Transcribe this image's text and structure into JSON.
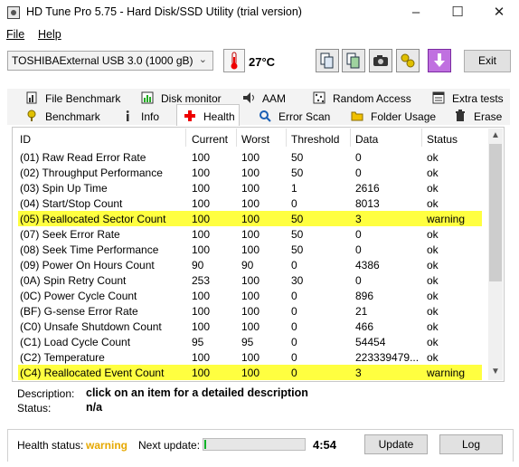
{
  "window": {
    "title": "HD Tune Pro 5.75 - Hard Disk/SSD Utility (trial version)",
    "controls": {
      "minimize": "–",
      "maximize": "☐",
      "close": "✕"
    }
  },
  "menu": {
    "file": "File",
    "help": "Help"
  },
  "toolbar": {
    "drive": "TOSHIBAExternal USB 3.0 (1000 gB)",
    "temperature": "27°C",
    "exit_label": "Exit",
    "icons": [
      "copy-info-icon",
      "copy-screenshot-icon",
      "camera-icon",
      "options-icon",
      "save-arrow-icon"
    ]
  },
  "tabs": {
    "row1": [
      {
        "label": "File Benchmark",
        "icon": "file-benchmark-icon"
      },
      {
        "label": "Disk monitor",
        "icon": "disk-monitor-icon"
      },
      {
        "label": "AAM",
        "icon": "speaker-icon"
      },
      {
        "label": "Random Access",
        "icon": "random-access-icon"
      },
      {
        "label": "Extra tests",
        "icon": "extra-tests-icon"
      }
    ],
    "row2": [
      {
        "label": "Benchmark",
        "icon": "benchmark-icon"
      },
      {
        "label": "Info",
        "icon": "info-icon"
      },
      {
        "label": "Health",
        "icon": "health-cross-icon"
      },
      {
        "label": "Error Scan",
        "icon": "error-scan-icon"
      },
      {
        "label": "Folder Usage",
        "icon": "folder-icon"
      },
      {
        "label": "Erase",
        "icon": "erase-icon"
      }
    ],
    "active": "Health"
  },
  "table": {
    "columns": [
      "ID",
      "Current",
      "Worst",
      "Threshold",
      "Data",
      "Status"
    ],
    "rows": [
      [
        "(01) Raw Read Error Rate",
        "100",
        "100",
        "50",
        "0",
        "ok"
      ],
      [
        "(02) Throughput Performance",
        "100",
        "100",
        "50",
        "0",
        "ok"
      ],
      [
        "(03) Spin Up Time",
        "100",
        "100",
        "1",
        "2616",
        "ok"
      ],
      [
        "(04) Start/Stop Count",
        "100",
        "100",
        "0",
        "8013",
        "ok"
      ],
      [
        "(05) Reallocated Sector Count",
        "100",
        "100",
        "50",
        "3",
        "warning"
      ],
      [
        "(07) Seek Error Rate",
        "100",
        "100",
        "50",
        "0",
        "ok"
      ],
      [
        "(08) Seek Time Performance",
        "100",
        "100",
        "50",
        "0",
        "ok"
      ],
      [
        "(09) Power On Hours Count",
        "90",
        "90",
        "0",
        "4386",
        "ok"
      ],
      [
        "(0A) Spin Retry Count",
        "253",
        "100",
        "30",
        "0",
        "ok"
      ],
      [
        "(0C) Power Cycle Count",
        "100",
        "100",
        "0",
        "896",
        "ok"
      ],
      [
        "(BF) G-sense Error Rate",
        "100",
        "100",
        "0",
        "21",
        "ok"
      ],
      [
        "(C0) Unsafe Shutdown Count",
        "100",
        "100",
        "0",
        "466",
        "ok"
      ],
      [
        "(C1) Load Cycle Count",
        "95",
        "95",
        "0",
        "54454",
        "ok"
      ],
      [
        "(C2) Temperature",
        "100",
        "100",
        "0",
        "223339479...",
        "ok"
      ],
      [
        "(C4) Reallocated Event Count",
        "100",
        "100",
        "0",
        "3",
        "warning"
      ]
    ],
    "highlight_color": "#ffff40"
  },
  "details": {
    "description_label": "Description:",
    "description_value": "click on an item for a detailed description",
    "status_label": "Status:",
    "status_value": "n/a"
  },
  "statusbar": {
    "health_label": "Health status:",
    "health_value": "warning",
    "health_color": "#e6a800",
    "next_update_label": "Next update:",
    "progress": 0.02,
    "countdown": "4:54",
    "update_label": "Update",
    "log_label": "Log"
  }
}
